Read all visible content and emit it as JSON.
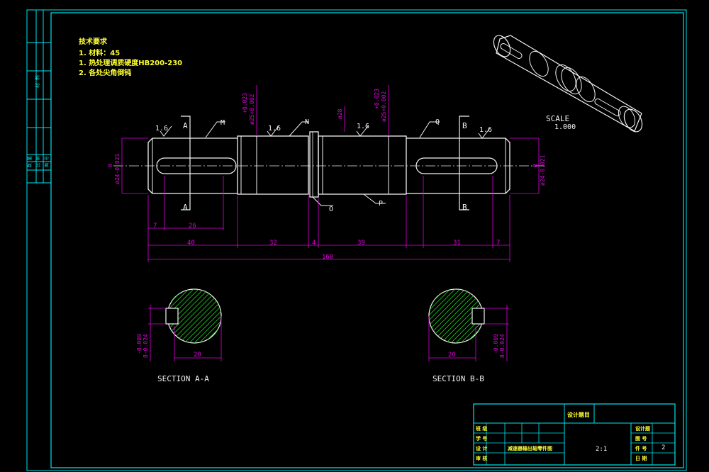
{
  "notes": {
    "title": "技术要求",
    "lines": [
      "1. 材料：45",
      "1. 热处理调质硬度HB200-230",
      "2. 各处尖角倒钝"
    ]
  },
  "scale": {
    "label": "SCALE",
    "value": "1.000"
  },
  "labels": {
    "roughness": "1.6",
    "section_a": "A",
    "section_b": "B",
    "M": "M",
    "N": "N",
    "O": "O",
    "P": "P",
    "Q": "Q"
  },
  "dimensions": {
    "d7_left": "7",
    "d26": "26",
    "d40": "40",
    "d32": "32",
    "d4": "4",
    "d39": "39",
    "d31": "31",
    "d7_right": "7",
    "d160": "160",
    "dia24_left": "ø24-0.021",
    "dia24_left_up": "0",
    "dia24_right": "ø24-0.021",
    "dia24_right_up": "0",
    "dia25_a": "ø25+0.002",
    "dia25_a_up": "+0.023",
    "dia25_b": "ø25+0.002",
    "dia25_b_up": "+0.023",
    "dia28": "ø28",
    "key_w_a": "8-0.024",
    "key_w_a_up": "-0.009",
    "key_w_b": "8-0.024",
    "key_w_b_up": "-0.009",
    "sec_w_a": "20",
    "sec_w_b": "20"
  },
  "sections": {
    "a": "SECTION   A-A",
    "b": "SECTION   B-B"
  },
  "title_block": {
    "heading": "设计题目",
    "rows_left": [
      "班 级",
      "学 号",
      "设 计",
      "审 核"
    ],
    "drawing_name": "减速器输出轴零件图",
    "scale_value": "2:1",
    "rows_right": [
      "设计题",
      "图 号",
      "件 号",
      "日 期"
    ],
    "part_number": "2"
  },
  "margin_strip": {
    "top": "材 料",
    "bottom": [
      "数 量",
      "比 例",
      "图 号"
    ]
  },
  "colors": {
    "frame": "#00e5ee",
    "outline": "#f2f2f2",
    "dimension": "#e000e0",
    "hatch": "#20c020",
    "notes": "#ffff33"
  }
}
